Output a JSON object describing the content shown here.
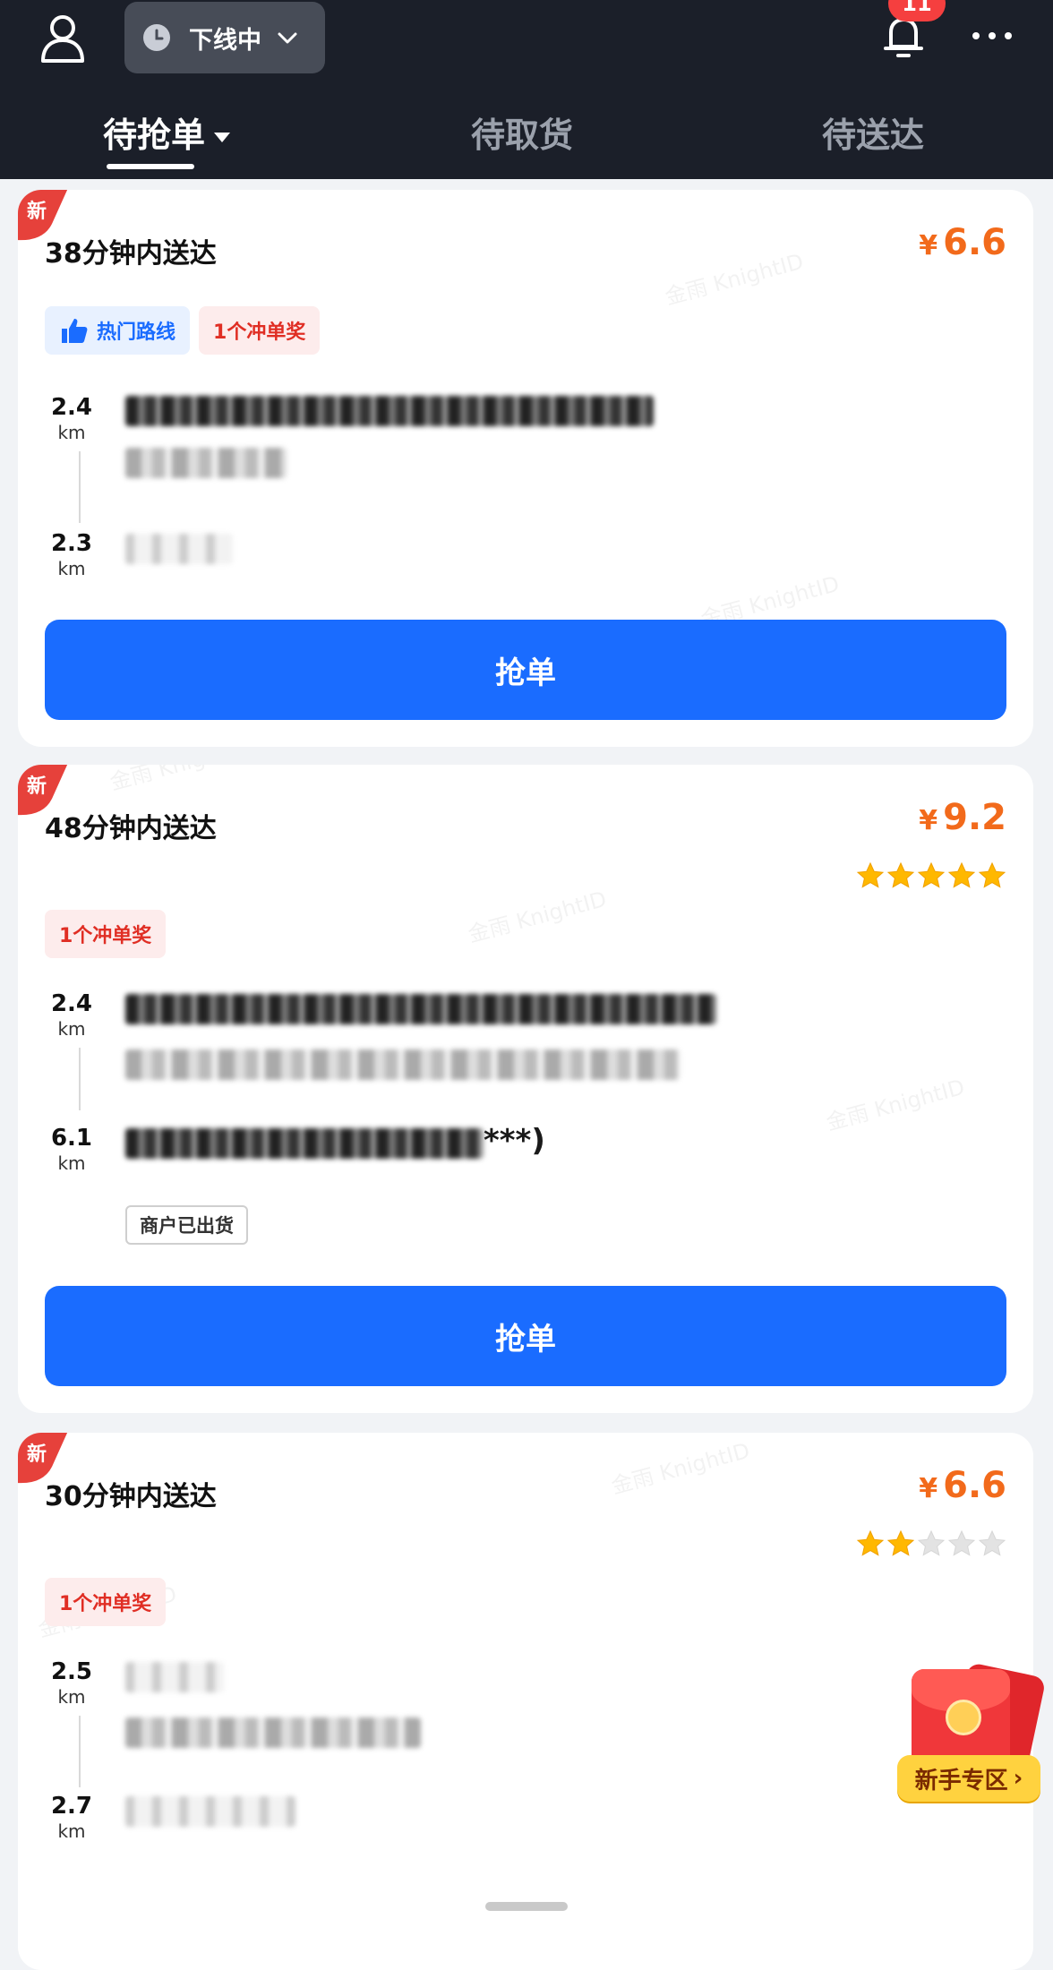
{
  "header": {
    "status_label": "下线中",
    "notification_count": "11",
    "tabs": [
      {
        "label": "待抢单",
        "active": true
      },
      {
        "label": "待取货",
        "active": false
      },
      {
        "label": "待送达",
        "active": false
      }
    ]
  },
  "colors": {
    "header_bg": "#1b1f29",
    "primary": "#1a6cff",
    "price": "#f26a1b",
    "new_tag": "#e6413b",
    "star_on": "#ffb800"
  },
  "orders": [
    {
      "new_label": "新",
      "deliver_time": "38分钟内送达",
      "currency": "¥",
      "price": "6.6",
      "tags": [
        "热门路线",
        "1个冲单奖"
      ],
      "pickup_distance": {
        "num": "2.4",
        "unit": "km"
      },
      "delivery_distance": {
        "num": "2.3",
        "unit": "km"
      },
      "button_label": "抢单"
    },
    {
      "new_label": "新",
      "deliver_time": "48分钟内送达",
      "currency": "¥",
      "price": "9.2",
      "rating": 5,
      "tags": [
        "1个冲单奖"
      ],
      "pickup_distance": {
        "num": "2.4",
        "unit": "km"
      },
      "delivery_distance": {
        "num": "6.1",
        "unit": "km"
      },
      "delivery_address_suffix": "***)",
      "merchant_status": "商户已出货",
      "button_label": "抢单"
    },
    {
      "new_label": "新",
      "deliver_time": "30分钟内送达",
      "currency": "¥",
      "price": "6.6",
      "rating": 2,
      "tags": [
        "1个冲单奖"
      ],
      "pickup_distance": {
        "num": "2.5",
        "unit": "km"
      },
      "delivery_distance": {
        "num": "2.7",
        "unit": "km"
      }
    }
  ],
  "promo": {
    "label": "新手专区"
  },
  "icons": {
    "avatar": "user-icon",
    "status": "clock-icon",
    "dropdown": "chevron-down-icon",
    "notifications": "bell-icon",
    "more": "more-icon",
    "hot_route": "thumbs-up-icon",
    "promo": "red-envelope-icon"
  }
}
